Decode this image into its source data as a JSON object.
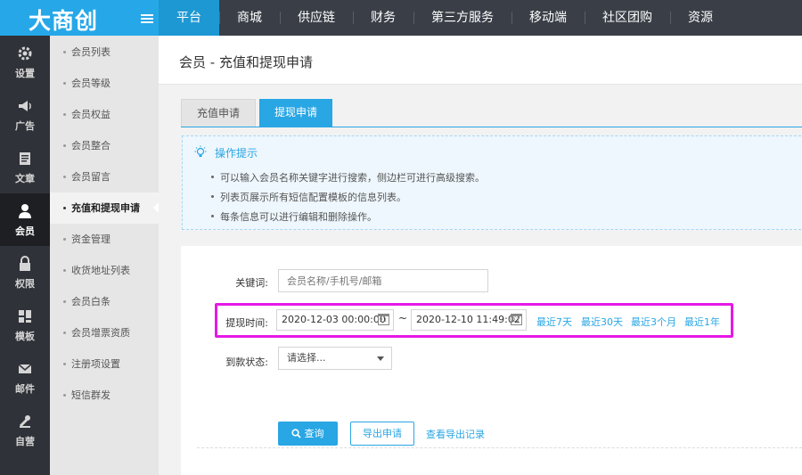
{
  "brand": {
    "logo": "大商创"
  },
  "nav": {
    "items": [
      {
        "label": "平台",
        "active": true
      },
      {
        "label": "商城"
      },
      {
        "label": "供应链"
      },
      {
        "label": "财务"
      },
      {
        "label": "第三方服务"
      },
      {
        "label": "移动端"
      },
      {
        "label": "社区团购"
      },
      {
        "label": "资源"
      }
    ]
  },
  "rail": {
    "items": [
      {
        "label": "设置",
        "icon": "gear-icon"
      },
      {
        "label": "广告",
        "icon": "megaphone-icon"
      },
      {
        "label": "文章",
        "icon": "document-icon"
      },
      {
        "label": "会员",
        "icon": "user-icon",
        "active": true
      },
      {
        "label": "权限",
        "icon": "lock-icon"
      },
      {
        "label": "模板",
        "icon": "grid-icon"
      },
      {
        "label": "邮件",
        "icon": "mail-icon"
      },
      {
        "label": "自营",
        "icon": "tools-icon"
      }
    ]
  },
  "submenu": {
    "items": [
      {
        "label": "会员列表"
      },
      {
        "label": "会员等级"
      },
      {
        "label": "会员权益"
      },
      {
        "label": "会员整合"
      },
      {
        "label": "会员留言"
      },
      {
        "label": "充值和提现申请",
        "active": true
      },
      {
        "label": "资金管理"
      },
      {
        "label": "收货地址列表"
      },
      {
        "label": "会员白条"
      },
      {
        "label": "会员增票资质"
      },
      {
        "label": "注册项设置"
      },
      {
        "label": "短信群发"
      }
    ]
  },
  "page": {
    "title": "会员 - 充值和提现申请"
  },
  "tabs": [
    {
      "label": "充值申请",
      "active": false
    },
    {
      "label": "提现申请",
      "active": true
    }
  ],
  "tips": {
    "title": "操作提示",
    "lines": [
      "可以输入会员名称关键字进行搜索，侧边栏可进行高级搜索。",
      "列表页展示所有短信配置模板的信息列表。",
      "每条信息可以进行编辑和删除操作。"
    ]
  },
  "form": {
    "keyword": {
      "label": "关键词:",
      "placeholder": "会员名称/手机号/邮箱"
    },
    "time": {
      "label": "提现时间:",
      "start": "2020-12-03 00:00:00",
      "separator": "~",
      "end": "2020-12-10 11:49:02",
      "quick": [
        "最近7天",
        "最近30天",
        "最近3个月",
        "最近1年"
      ]
    },
    "status": {
      "label": "到款状态:",
      "value": "请选择..."
    },
    "buttons": {
      "search": "查询",
      "export": "导出申请",
      "history": "查看导出记录"
    }
  },
  "colors": {
    "accent": "#29a6e4",
    "topbar": "#3a3f47",
    "highlight": "#e619e6"
  }
}
